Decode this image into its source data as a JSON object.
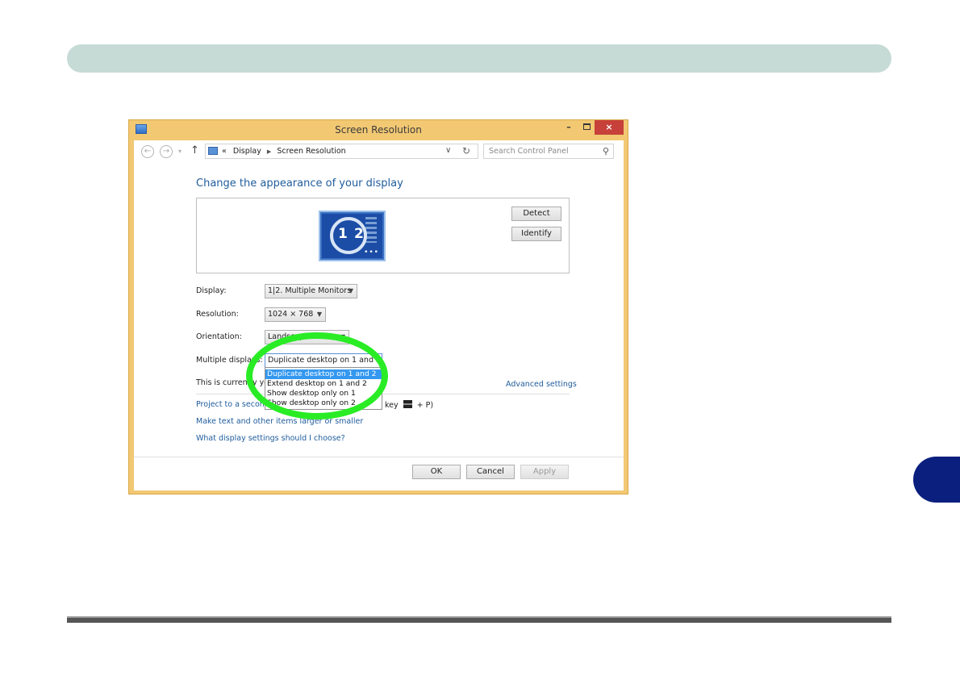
{
  "window": {
    "title": "Screen Resolution",
    "minimize": "–",
    "close": "×"
  },
  "nav": {
    "back": "←",
    "forward": "→",
    "dropdown": "▾",
    "up": "↑",
    "breadcrumb_prefix": "«",
    "crumbs": [
      "Display",
      "Screen Resolution"
    ],
    "separator": "▶",
    "chevron": "∨",
    "refresh": "↻",
    "search_placeholder": "Search Control Panel",
    "search_icon": "⚲"
  },
  "main": {
    "heading": "Change the appearance of your display",
    "monitor": {
      "num1": "1",
      "num2": "2",
      "dots": "•••"
    },
    "detect_label": "Detect",
    "identify_label": "Identify",
    "fields": {
      "display_label": "Display:",
      "display_value": "1|2. Multiple Monitors",
      "resolution_label": "Resolution:",
      "resolution_value": "1024 × 768",
      "orientation_label": "Orientation:",
      "orientation_value": "Landscape",
      "multiple_label": "Multiple displays:",
      "multiple_value": "Duplicate desktop on 1 and 2"
    },
    "dropdown_options": [
      "Duplicate desktop on 1 and 2",
      "Extend desktop on 1 and 2",
      "Show desktop only on 1",
      "Show desktop only on 2"
    ],
    "status_text": "This is currently you",
    "advanced_link": "Advanced settings",
    "project_link": "Project to a second",
    "project_tail_a": "key",
    "project_tail_b": "+ P)",
    "larger_link": "Make text and other items larger or smaller",
    "which_link": "What display settings should I choose?"
  },
  "footer": {
    "ok": "OK",
    "cancel": "Cancel",
    "apply": "Apply"
  },
  "colors": {
    "top_bar": "#c6dbd6",
    "chapter_tab": "#0a1f7e",
    "window_frame": "#f2c873",
    "highlight_ring": "#29ec25",
    "link": "#1f5c9c",
    "selection": "#3498f0"
  }
}
